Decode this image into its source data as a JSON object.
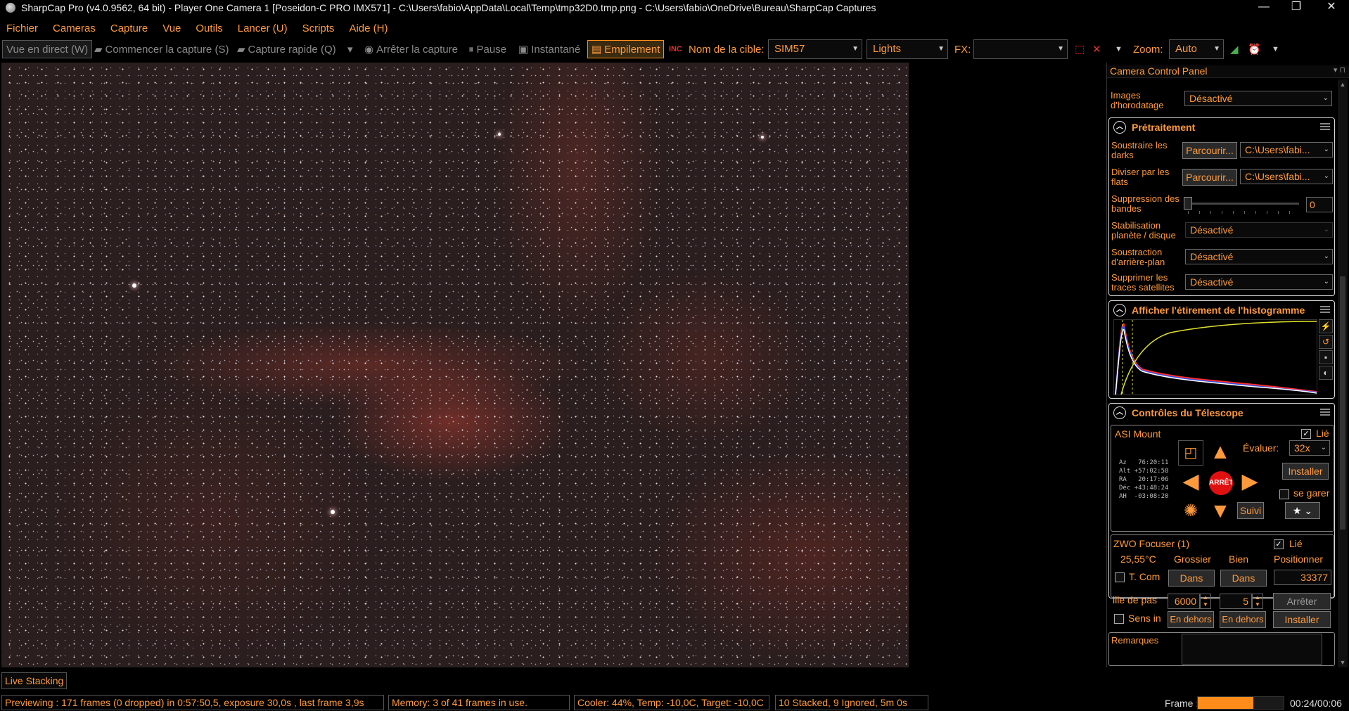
{
  "window": {
    "title": "SharpCap Pro (v4.0.9562, 64 bit) - Player One Camera 1 [Poseidon-C PRO IMX571] - C:\\Users\\fabio\\AppData\\Local\\Temp\\tmp32D0.tmp.png - C:\\Users\\fabio\\OneDrive\\Bureau\\SharpCap Captures",
    "minimize": "—",
    "maximize": "❐",
    "close": "✕"
  },
  "menu": [
    "Fichier",
    "Cameras",
    "Capture",
    "Vue",
    "Outils",
    "Lancer (U)",
    "Scripts",
    "Aide (H)"
  ],
  "toolbar": {
    "live_view": "Vue en direct (W)",
    "start_capture": "Commencer la capture (S)",
    "quick_capture": "Capture rapide (Q)",
    "stop_capture": "Arrêter la capture",
    "pause": "Pause",
    "snapshot": "Instantané",
    "stacking": "Empilement",
    "target_label": "Nom de la cible:",
    "target_value": "SIM57",
    "frame_type": "Lights",
    "fx_label": "FX:",
    "fx_value": "",
    "zoom_label": "Zoom:",
    "zoom_value": "Auto"
  },
  "live_tab": "Live Stacking",
  "status": {
    "preview": "Previewing : 171 frames (0 dropped) in 0:57:50,5, exposure 30,0s , last frame 3,9s",
    "memory": "Memory: 3 of 41 frames in use.",
    "cooler": "Cooler: 44%, Temp: -10,0C, Target: -10,0C",
    "stacked": "10 Stacked, 9 Ignored, 5m 0s",
    "frame_label": "Frame :",
    "frame_progress": 0.65,
    "frame_time": "00:24/00:06"
  },
  "panel": {
    "title": "Camera Control Panel",
    "timestamp_label": "Images d'horodatage",
    "timestamp_value": "Désactivé",
    "preprocess": {
      "header": "Prétraitement",
      "darks_label": "Soustraire les darks",
      "browse": "Parcourir...",
      "darks_path": "C:\\Users\\fabi...",
      "flats_label": "Diviser par les flats",
      "flats_path": "C:\\Users\\fabi...",
      "banding_label": "Suppression des bandes",
      "banding_value": "0",
      "stab_label": "Stabilisation planète / disque",
      "stab_value": "Désactivé",
      "bg_label": "Soustraction d'arrière-plan",
      "bg_value": "Désactivé",
      "sat_label": "Supprimer les traces satellites",
      "sat_value": "Désactivé"
    },
    "histogram": {
      "header": "Afficher l'étirement de l'histogramme"
    },
    "telescope": {
      "header": "Contrôles du Télescope",
      "mount": "ASI Mount",
      "linked": "Lié",
      "stop": "ARRÊTE",
      "rate_label": "Évaluer:",
      "rate_value": "32x",
      "install": "Installer",
      "park": "se garer",
      "track": "Suivi",
      "coords": "Az   76:20:11\nAlt +57:02:58\nRA   20:17:06\nDéc +43:48:24\nAH  -03:08:20"
    },
    "focuser": {
      "name": "ZWO Focuser (1)",
      "linked": "Lié",
      "temp": "25,55°C",
      "coarse": "Grossier",
      "fine": "Bien",
      "position_label": "Positionner",
      "tcomp": "T. Com",
      "in1": "Dans",
      "in2": "Dans",
      "position": "33377",
      "step_label": "ille de pas",
      "step_coarse": "6000",
      "step_fine": "5",
      "stop": "Arrêter",
      "reverse": "Sens in",
      "out1": "En dehors",
      "out2": "En dehors",
      "install": "Installer"
    },
    "notes_label": "Remarques"
  }
}
